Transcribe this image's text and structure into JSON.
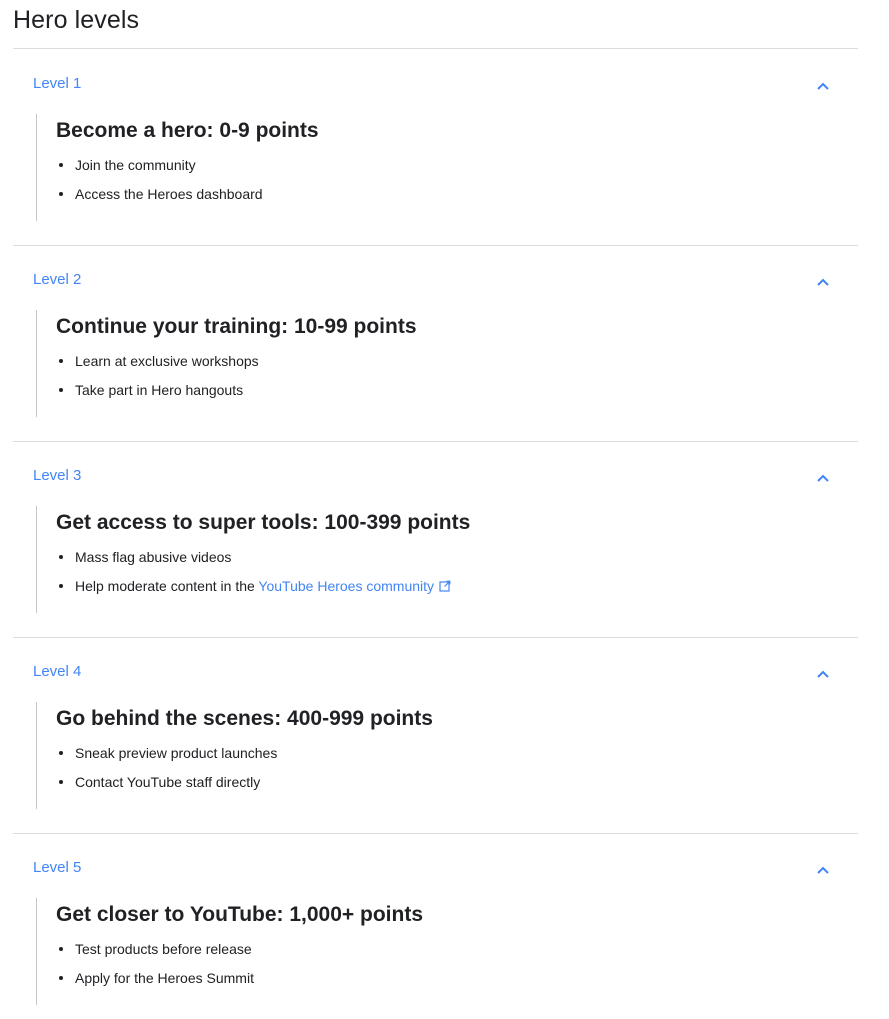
{
  "page": {
    "title": "Hero levels"
  },
  "levels": [
    {
      "label": "Level 1",
      "heading": "Become a hero: 0-9 points",
      "bullets": [
        {
          "text": "Join the community"
        },
        {
          "text": "Access the Heroes dashboard"
        }
      ]
    },
    {
      "label": "Level 2",
      "heading": "Continue your training: 10-99 points",
      "bullets": [
        {
          "text": "Learn at exclusive workshops"
        },
        {
          "text": "Take part in Hero hangouts"
        }
      ]
    },
    {
      "label": "Level 3",
      "heading": "Get access to super tools: 100-399 points",
      "bullets": [
        {
          "text": "Mass flag abusive videos"
        },
        {
          "text": "Help moderate content in the ",
          "link_text": "YouTube Heroes community"
        }
      ]
    },
    {
      "label": "Level 4",
      "heading": "Go behind the scenes: 400-999 points",
      "bullets": [
        {
          "text": "Sneak preview product launches"
        },
        {
          "text": "Contact YouTube staff directly"
        }
      ]
    },
    {
      "label": "Level 5",
      "heading": "Get closer to YouTube: 1,000+ points",
      "bullets": [
        {
          "text": "Test products before release"
        },
        {
          "text": "Apply for the Heroes Summit"
        }
      ]
    }
  ],
  "colors": {
    "accent": "#4285f4",
    "text": "#202124",
    "divider": "#dadce0"
  },
  "icons": {
    "expander": "chevron-up-icon",
    "external_link": "external-link-icon"
  }
}
